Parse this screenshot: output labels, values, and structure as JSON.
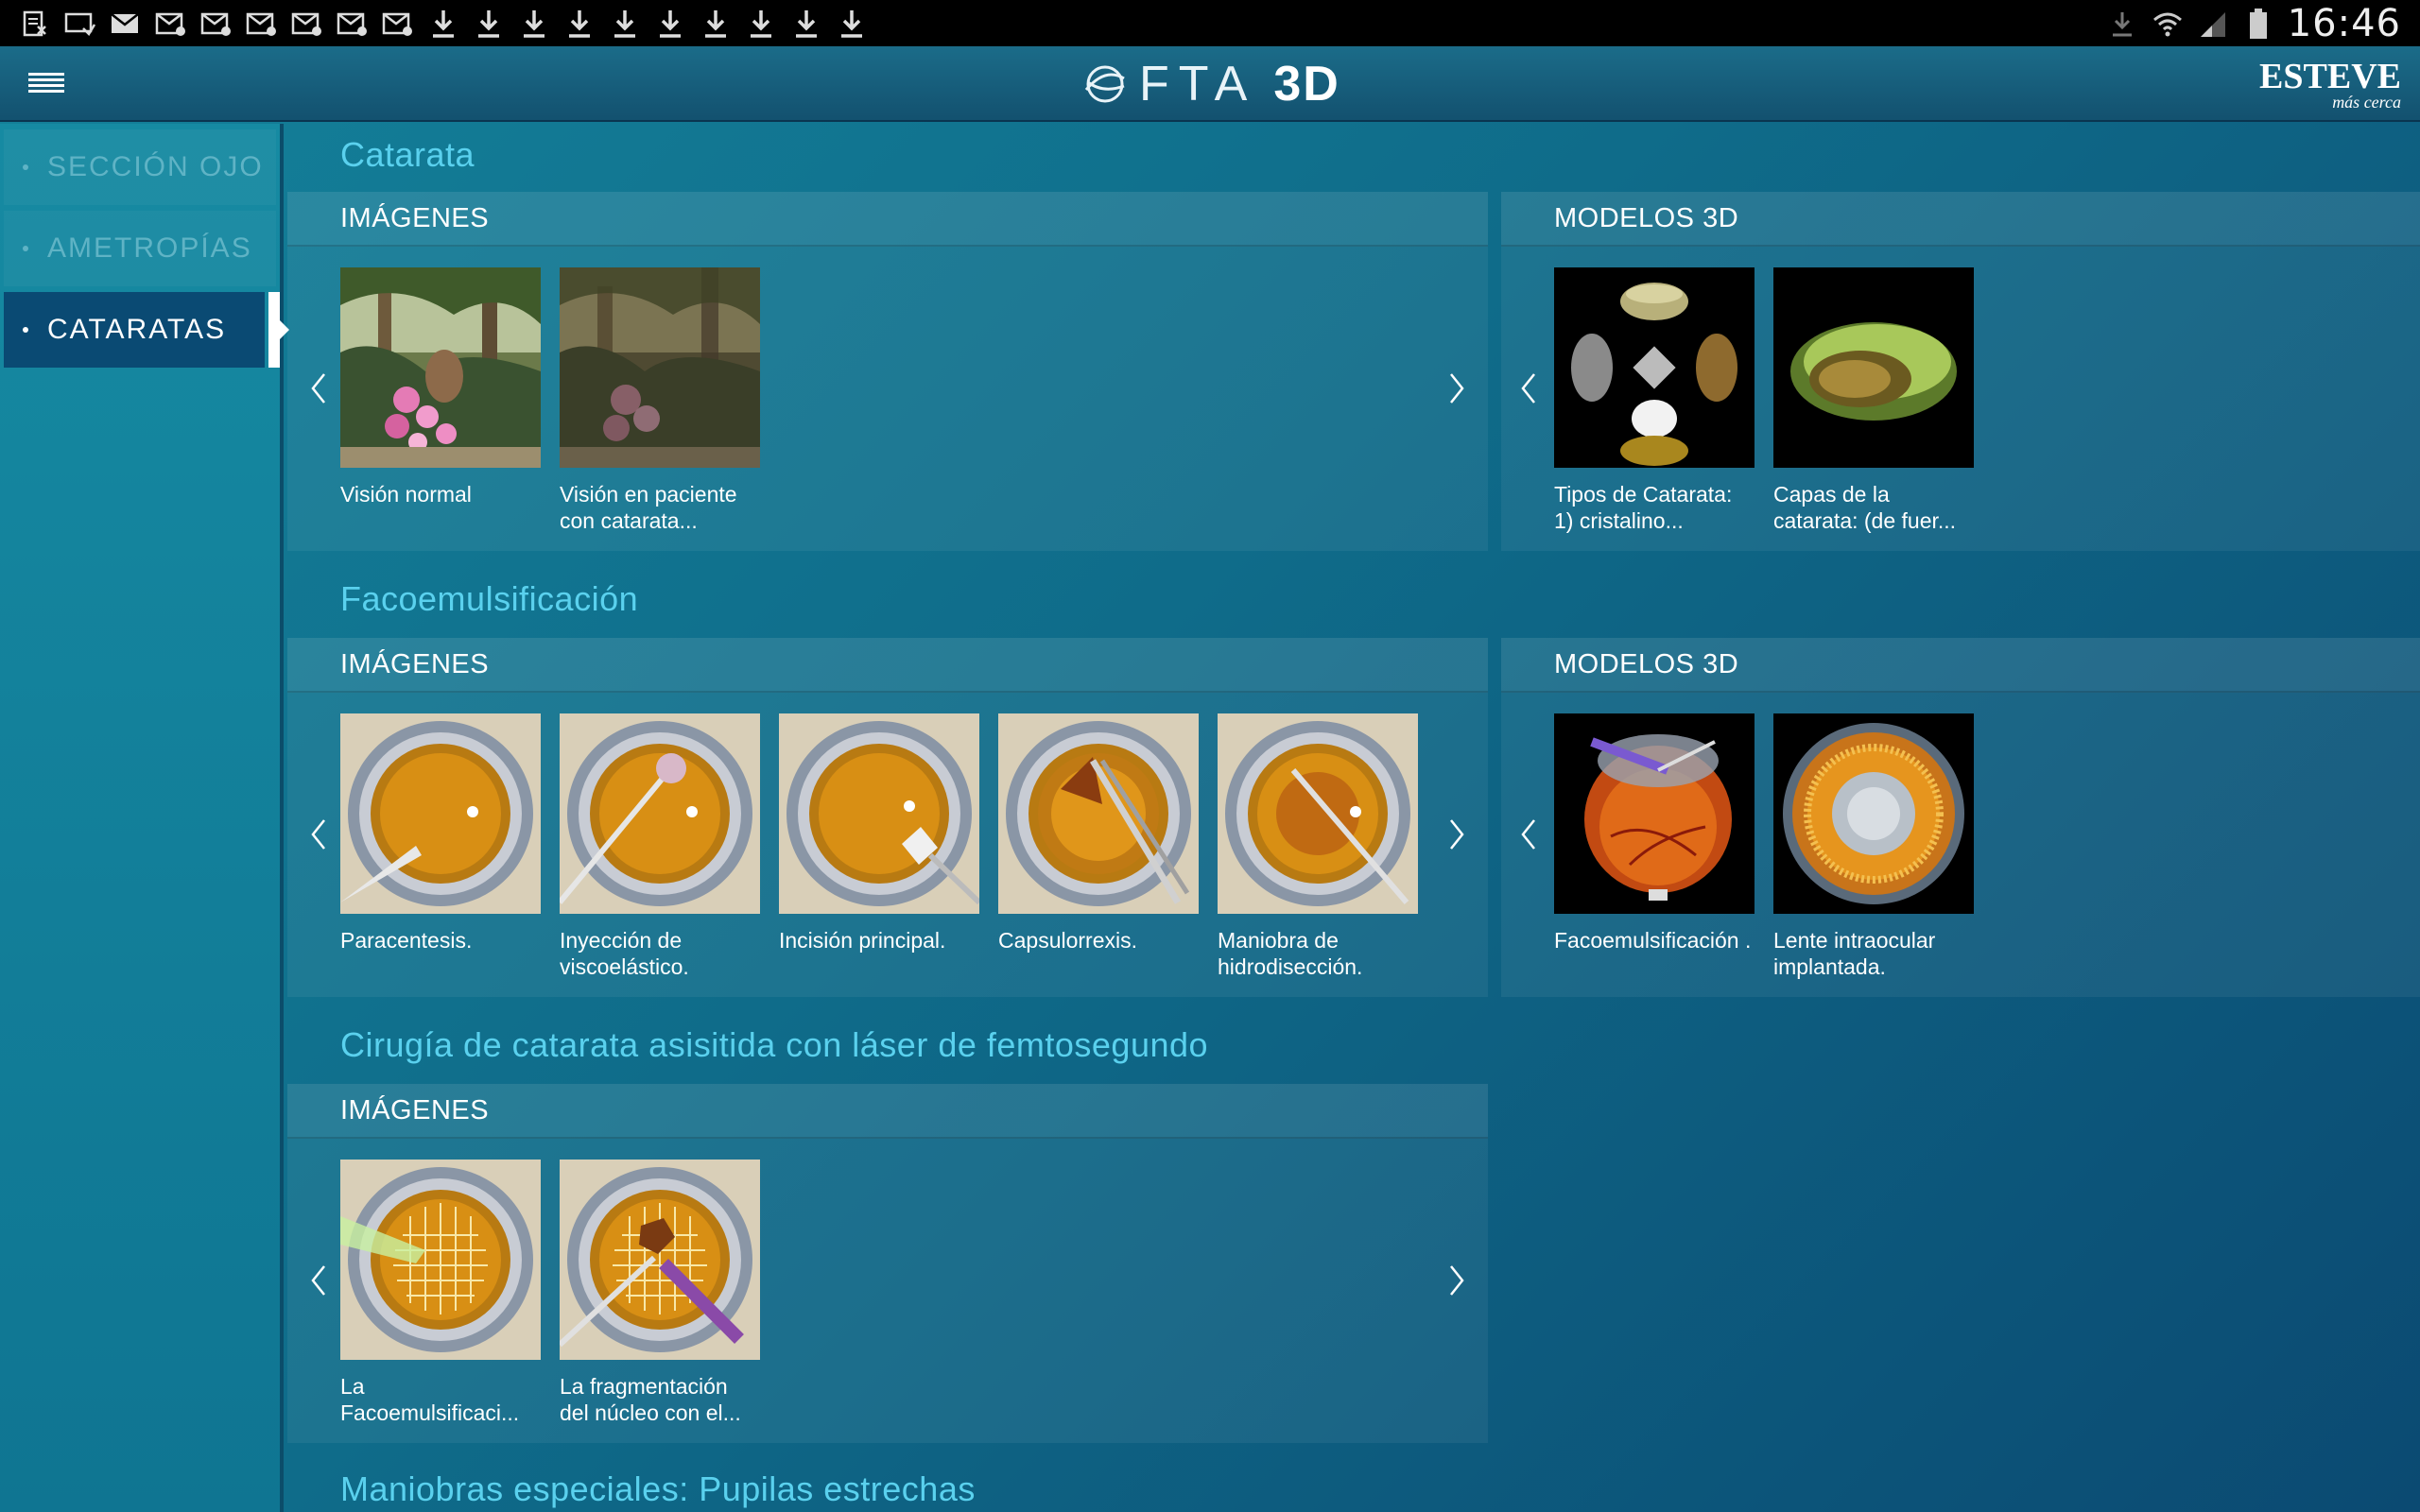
{
  "status": {
    "time": "16:46",
    "left_icons": [
      "notification-icon",
      "message-icon",
      "mail-icon",
      "mail-icon",
      "mail-icon",
      "mail-icon",
      "mail-icon",
      "mail-icon",
      "mail-icon",
      "download-icon",
      "download-icon",
      "download-icon",
      "download-icon",
      "download-icon",
      "download-icon",
      "download-icon",
      "download-icon",
      "download-icon"
    ]
  },
  "header": {
    "logo_text": "FTA",
    "logo_3d": "3D",
    "brand_name": "ESTEVE",
    "brand_tag": "más cerca"
  },
  "sidebar": {
    "items": [
      {
        "label": "SECCIÓN OJO"
      },
      {
        "label": "AMETROPÍAS"
      },
      {
        "label": "CATARATAS"
      }
    ]
  },
  "sections": {
    "catarata": {
      "title": "Catarata",
      "images_label": "IMÁGENES",
      "models_label": "MODELOS 3D",
      "images": [
        {
          "caption": "Visión normal"
        },
        {
          "caption": "Visión en paciente con catarata..."
        }
      ],
      "models": [
        {
          "caption": "Tipos de Catarata: 1) cristalino..."
        },
        {
          "caption": "Capas de la catarata: (de fuer..."
        }
      ]
    },
    "faco": {
      "title": "Facoemulsificación",
      "images_label": "IMÁGENES",
      "models_label": "MODELOS 3D",
      "images": [
        {
          "caption": "Paracentesis."
        },
        {
          "caption": "Inyección de viscoelástico."
        },
        {
          "caption": "Incisión principal."
        },
        {
          "caption": "Capsulorrexis."
        },
        {
          "caption": "Maniobra de hidrodisección."
        }
      ],
      "models": [
        {
          "caption": "Facoemulsificación ."
        },
        {
          "caption": "Lente intraocular implantada."
        }
      ]
    },
    "laser": {
      "title": "Cirugía de catarata asisitida con láser de femtosegundo",
      "images_label": "IMÁGENES",
      "images": [
        {
          "caption": "La Facoemulsificaci..."
        },
        {
          "caption": "La fragmentación del núcleo con el..."
        }
      ]
    },
    "pupilas": {
      "title": "Maniobras especiales: Pupilas estrechas"
    }
  }
}
